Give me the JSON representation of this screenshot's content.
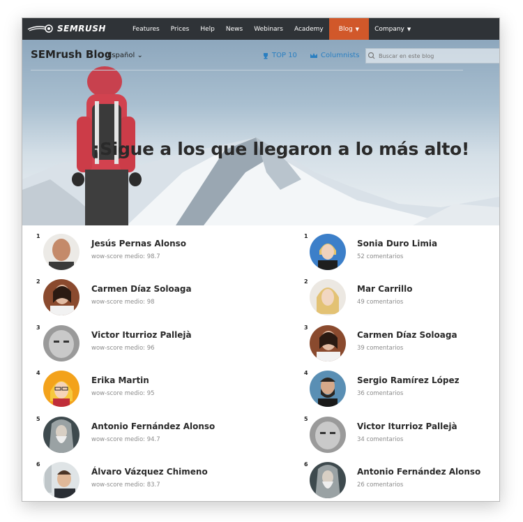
{
  "nav": {
    "logo_text": "SEMRUSH",
    "links": [
      "Features",
      "Prices",
      "Help",
      "News",
      "Webinars",
      "Academy"
    ],
    "blog": "Blog",
    "company": "Company",
    "active_color": "#d1582a"
  },
  "subheader": {
    "brand": "SEMrush Blog",
    "language": "Español",
    "top10": "TOP 10",
    "columnists": "Columnists",
    "search_placeholder": "Buscar en este blog"
  },
  "hero": {
    "headline": "¡Sigue a los que llegaron a lo más alto!"
  },
  "left_list": [
    {
      "rank": "1",
      "name": "Jesús Pernas Alonso",
      "meta": "wow-score medio: 98.7"
    },
    {
      "rank": "2",
      "name": "Carmen Díaz Soloaga",
      "meta": "wow-score medio: 98"
    },
    {
      "rank": "3",
      "name": "Victor Iturrioz Pallejà",
      "meta": "wow-score medio: 96"
    },
    {
      "rank": "4",
      "name": "Erika Martin",
      "meta": "wow-score medio: 95"
    },
    {
      "rank": "5",
      "name": "Antonio Fernández Alonso",
      "meta": "wow-score medio: 94.7"
    },
    {
      "rank": "6",
      "name": "Álvaro Vázquez Chimeno",
      "meta": "wow-score medio: 83.7"
    }
  ],
  "right_list": [
    {
      "rank": "1",
      "name": "Sonia Duro Limia",
      "meta": "52 comentarios"
    },
    {
      "rank": "2",
      "name": "Mar Carrillo",
      "meta": "49 comentarios"
    },
    {
      "rank": "3",
      "name": "Carmen Díaz Soloaga",
      "meta": "39 comentarios"
    },
    {
      "rank": "4",
      "name": "Sergio Ramírez López",
      "meta": "36 comentarios"
    },
    {
      "rank": "5",
      "name": "Victor Iturrioz Pallejà",
      "meta": "34 comentarios"
    },
    {
      "rank": "6",
      "name": "Antonio Fernández Alonso",
      "meta": "26 comentarios"
    }
  ]
}
